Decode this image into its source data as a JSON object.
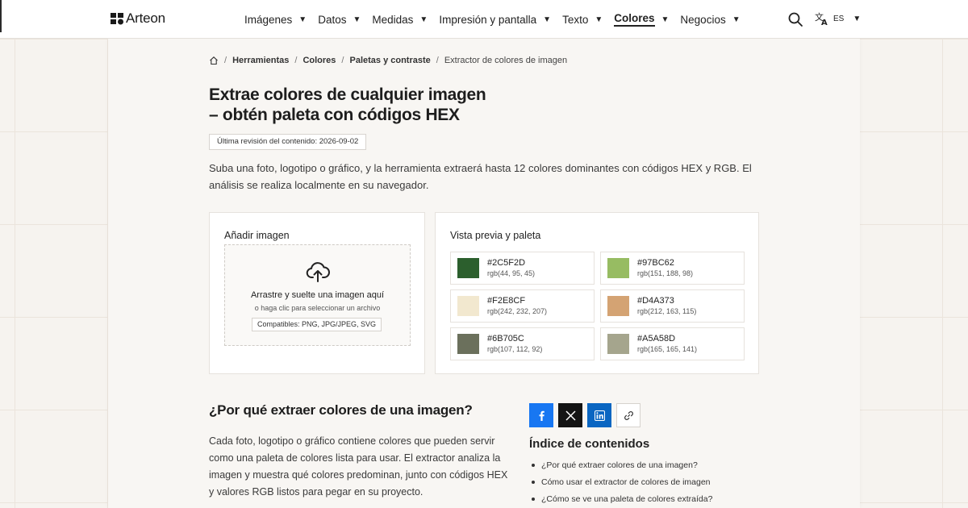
{
  "brand": {
    "name": "Arteon"
  },
  "nav": {
    "items": [
      {
        "label": "Imágenes",
        "active": false
      },
      {
        "label": "Datos",
        "active": false
      },
      {
        "label": "Medidas",
        "active": false
      },
      {
        "label": "Impresión y pantalla",
        "active": false
      },
      {
        "label": "Texto",
        "active": false
      },
      {
        "label": "Colores",
        "active": true
      },
      {
        "label": "Negocios",
        "active": false
      }
    ],
    "caret": "▼",
    "language": "ES"
  },
  "breadcrumb": {
    "separator": "/",
    "items": [
      "Herramientas",
      "Colores",
      "Paletas y contraste"
    ],
    "current": "Extractor de colores de imagen"
  },
  "hero": {
    "title_line1": "Extrae colores de cualquier imagen",
    "title_line2": "– obtén paleta con códigos HEX",
    "revision": "Última revisión del contenido: 2026-09-02",
    "intro": "Suba una foto, logotipo o gráfico, y la herramienta extraerá hasta 12 colores dominantes con códigos HEX y RGB. El análisis se realiza localmente en su navegador."
  },
  "upload": {
    "title": "Añadir imagen",
    "drop_main": "Arrastre y suelte una imagen aquí",
    "drop_sub": "o haga clic para seleccionar un archivo",
    "compat": "Compatibles: PNG, JPG/JPEG, SVG"
  },
  "preview": {
    "title": "Vista previa y paleta",
    "swatches": [
      {
        "hex": "#2C5F2D",
        "rgb": "rgb(44, 95, 45)",
        "color": "#2C5F2D"
      },
      {
        "hex": "#97BC62",
        "rgb": "rgb(151, 188, 98)",
        "color": "#97BC62"
      },
      {
        "hex": "#F2E8CF",
        "rgb": "rgb(242, 232, 207)",
        "color": "#F2E8CF"
      },
      {
        "hex": "#D4A373",
        "rgb": "rgb(212, 163, 115)",
        "color": "#D4A373"
      },
      {
        "hex": "#6B705C",
        "rgb": "rgb(107, 112, 92)",
        "color": "#6B705C"
      },
      {
        "hex": "#A5A58D",
        "rgb": "rgb(165, 165, 141)",
        "color": "#A5A58D"
      }
    ]
  },
  "why": {
    "title": "¿Por qué extraer colores de una imagen?",
    "text": "Cada foto, logotipo o gráfico contiene colores que pueden servir como una paleta de colores lista para usar. El extractor analiza la imagen y muestra qué colores predominan, junto con códigos HEX y valores RGB listos para pegar en su proyecto."
  },
  "toc": {
    "title": "Índice de contenidos",
    "items": [
      "¿Por qué extraer colores de una imagen?",
      "Cómo usar el extractor de colores de imagen",
      "¿Cómo se ve una paleta de colores extraída?"
    ]
  },
  "colors": {
    "facebook": "#1877f2",
    "x": "#141414",
    "linkedin": "#0a66c2"
  }
}
